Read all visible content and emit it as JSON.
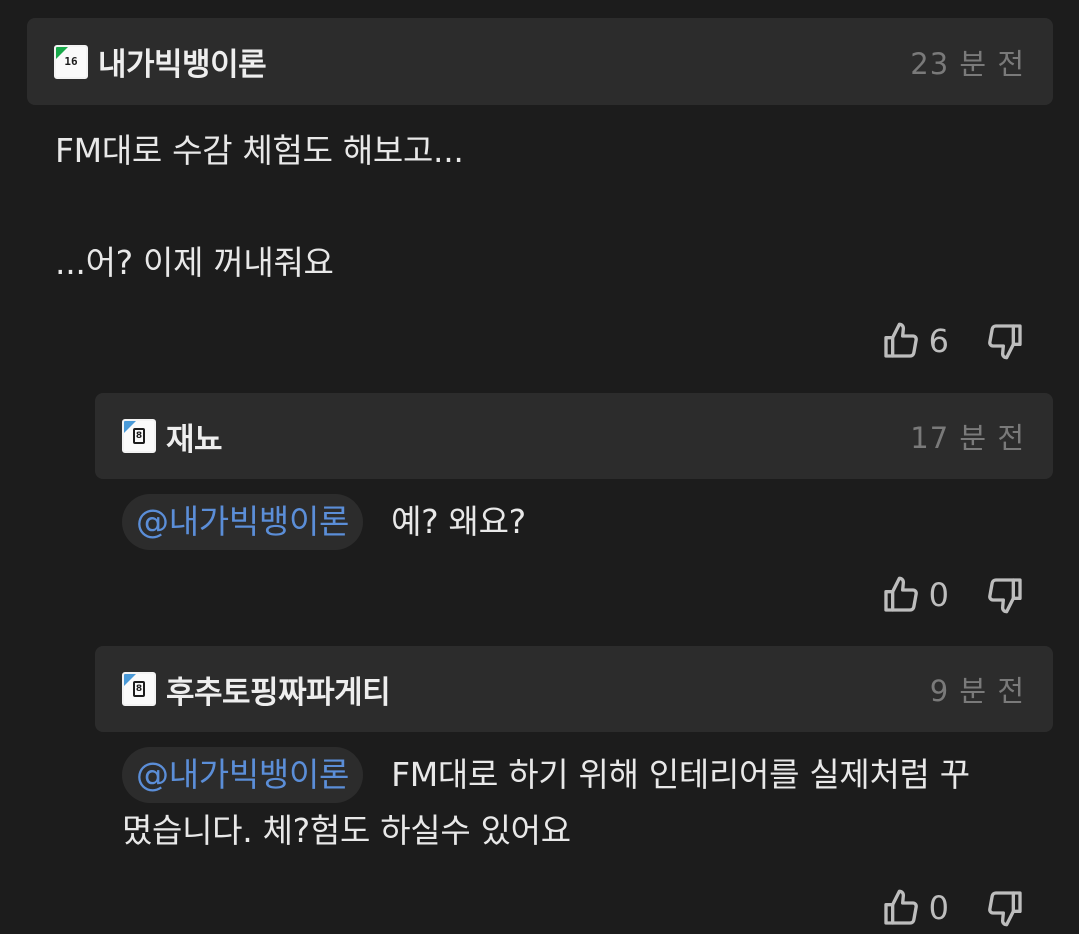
{
  "comments": [
    {
      "author": "내가빅뱅이론",
      "badge": "16",
      "badge_color": "#18a94a",
      "time": "23 분 전",
      "lines": [
        "FM대로 수감 체험도 해보고...",
        "",
        "...어? 이제 꺼내줘요"
      ],
      "likes": "6"
    },
    {
      "author": "재뇨",
      "badge": "8",
      "badge_color": "#4a9ad8",
      "time": "17 분 전",
      "mention": "@내가빅뱅이론",
      "text": "예? 왜요?",
      "likes": "0"
    },
    {
      "author": "후추토핑짜파게티",
      "badge": "8",
      "badge_color": "#4a9ad8",
      "time": "9 분 전",
      "mention": "@내가빅뱅이론",
      "text": "FM대로 하기 위해 인테리어를 실제처럼 꾸",
      "text_line2": "몄습니다. 체?험도 하실수 있어요",
      "likes": "0"
    }
  ],
  "icons": {
    "like": "thumbs-up-icon",
    "dislike": "thumbs-down-icon"
  }
}
